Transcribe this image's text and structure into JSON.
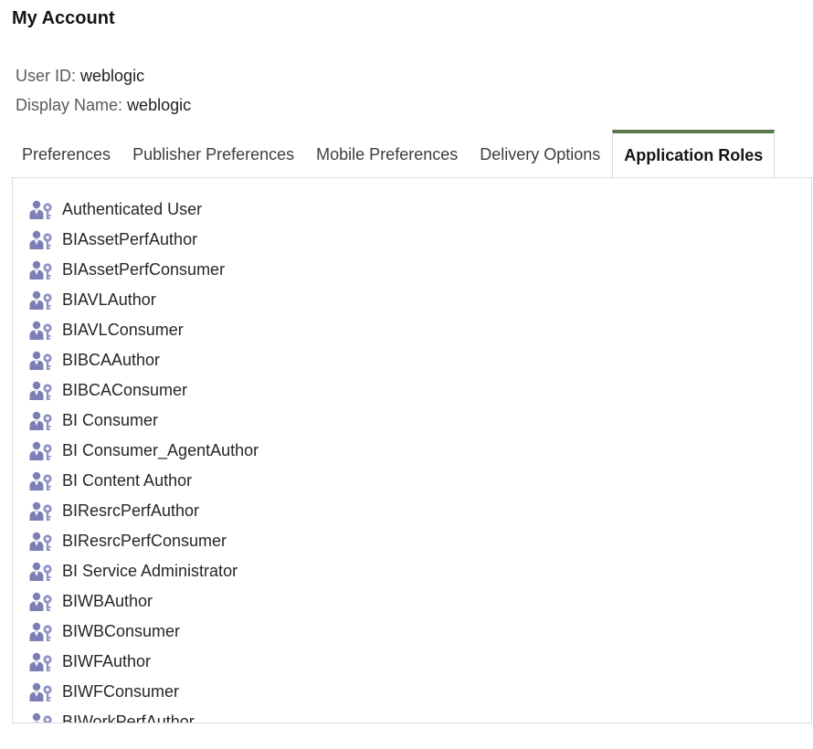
{
  "page": {
    "title": "My Account"
  },
  "user": {
    "user_id_label": "User ID:",
    "user_id": "weblogic",
    "display_name_label": "Display Name:",
    "display_name": "weblogic"
  },
  "tabs": [
    {
      "label": "Preferences",
      "active": false
    },
    {
      "label": "Publisher Preferences",
      "active": false
    },
    {
      "label": "Mobile Preferences",
      "active": false
    },
    {
      "label": "Delivery Options",
      "active": false
    },
    {
      "label": "Application Roles",
      "active": true
    }
  ],
  "roles": [
    {
      "label": "Authenticated User",
      "icon": "user-role-icon"
    },
    {
      "label": "BIAssetPerfAuthor",
      "icon": "user-role-icon"
    },
    {
      "label": "BIAssetPerfConsumer",
      "icon": "user-role-icon"
    },
    {
      "label": "BIAVLAuthor",
      "icon": "user-role-icon"
    },
    {
      "label": "BIAVLConsumer",
      "icon": "user-role-icon"
    },
    {
      "label": "BIBCAAuthor",
      "icon": "user-role-icon"
    },
    {
      "label": "BIBCAConsumer",
      "icon": "user-role-icon"
    },
    {
      "label": "BI Consumer",
      "icon": "user-role-icon"
    },
    {
      "label": "BI Consumer_AgentAuthor",
      "icon": "user-role-icon"
    },
    {
      "label": "BI Content Author",
      "icon": "user-role-icon"
    },
    {
      "label": "BIResrcPerfAuthor",
      "icon": "user-role-icon"
    },
    {
      "label": "BIResrcPerfConsumer",
      "icon": "user-role-icon"
    },
    {
      "label": "BI Service Administrator",
      "icon": "user-role-icon"
    },
    {
      "label": "BIWBAuthor",
      "icon": "user-role-icon"
    },
    {
      "label": "BIWBConsumer",
      "icon": "user-role-icon"
    },
    {
      "label": "BIWFAuthor",
      "icon": "user-role-icon"
    },
    {
      "label": "BIWFConsumer",
      "icon": "user-role-icon"
    },
    {
      "label": "BIWorkPerfAuthor",
      "icon": "user-role-icon"
    }
  ],
  "colors": {
    "active_tab_accent": "#5a7a4a",
    "icon_color": "#7b7fb5"
  }
}
